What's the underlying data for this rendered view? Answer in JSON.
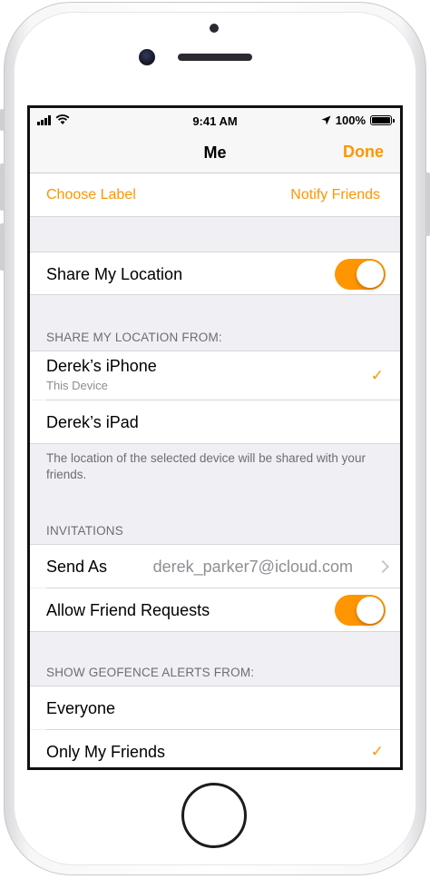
{
  "status_bar": {
    "time": "9:41 AM",
    "battery_percent": "100%"
  },
  "nav": {
    "title": "Me",
    "done_label": "Done"
  },
  "actions": {
    "choose_label": "Choose Label",
    "notify_friends": "Notify Friends"
  },
  "share_location": {
    "label": "Share My Location",
    "on": true
  },
  "share_from": {
    "header": "SHARE MY LOCATION FROM:",
    "devices": [
      {
        "name": "Derek’s iPhone",
        "subtitle": "This Device",
        "selected": true
      },
      {
        "name": "Derek’s iPad",
        "subtitle": "",
        "selected": false
      }
    ],
    "footer": "The location of the selected device will be shared with your friends."
  },
  "invitations": {
    "header": "INVITATIONS",
    "send_as_label": "Send As",
    "send_as_value": "derek_parker7@icloud.com",
    "allow_requests_label": "Allow Friend Requests",
    "allow_requests_on": true
  },
  "geofence": {
    "header": "SHOW GEOFENCE ALERTS FROM:",
    "options": [
      {
        "label": "Everyone",
        "selected": false
      },
      {
        "label": "Only My Friends",
        "selected": true
      }
    ]
  },
  "check_glyph": "✓",
  "colors": {
    "accent": "#ff9500",
    "group_bg": "#efeff4",
    "secondary_text": "#8e8e93"
  }
}
